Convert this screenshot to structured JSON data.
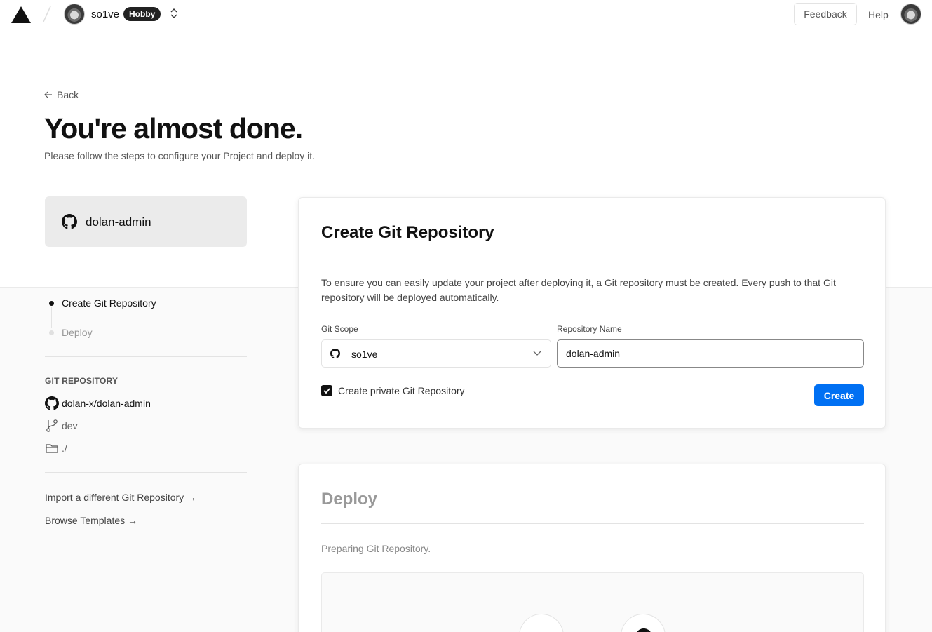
{
  "nav": {
    "team_name": "so1ve",
    "plan_badge": "Hobby",
    "feedback_label": "Feedback",
    "help_label": "Help"
  },
  "header": {
    "back_label": "Back",
    "title": "You're almost done.",
    "subtitle": "Please follow the steps to configure your Project and deploy it."
  },
  "repo_card": {
    "name": "dolan-admin"
  },
  "steps": [
    {
      "label": "Create Git Repository",
      "state": "active"
    },
    {
      "label": "Deploy",
      "state": "pending"
    }
  ],
  "git_repository": {
    "heading": "GIT REPOSITORY",
    "repo": "dolan-x/dolan-admin",
    "branch": "dev",
    "directory": "./"
  },
  "links": {
    "import_label": "Import a different Git Repository →",
    "templates_label": "Browse Templates →"
  },
  "create_card": {
    "title": "Create Git Repository",
    "description": "To ensure you can easily update your project after deploying it, a Git repository must be created. Every push to that Git repository will be deployed automatically.",
    "scope_label": "Git Scope",
    "scope_value": "so1ve",
    "name_label": "Repository Name",
    "name_value": "dolan-admin",
    "private_label": "Create private Git Repository",
    "private_checked": true,
    "create_label": "Create"
  },
  "deploy_card": {
    "title": "Deploy",
    "status": "Preparing Git Repository."
  },
  "colors": {
    "accent": "#0070f3",
    "badge_bg": "#222222",
    "band_bg": "#fafafa"
  }
}
